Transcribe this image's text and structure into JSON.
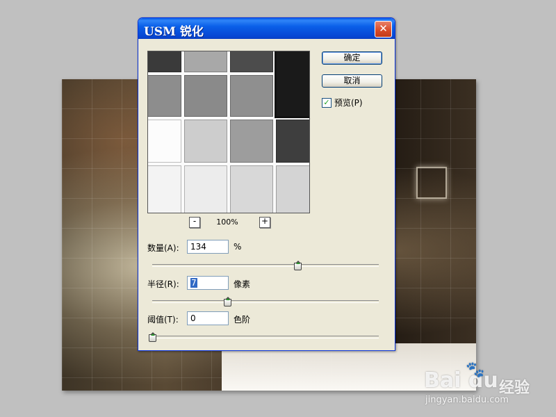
{
  "dialog": {
    "title": "USM 锐化",
    "close_label": "✕",
    "ok_label": "确定",
    "cancel_label": "取消",
    "preview_checkbox": {
      "label": "预览(P)",
      "checked": true,
      "check_mark": "✓"
    }
  },
  "preview": {
    "zoom_out_label": "-",
    "zoom_in_label": "+",
    "zoom_level": "100%"
  },
  "params": {
    "amount": {
      "label": "数量(A):",
      "value": "134",
      "unit": "%",
      "slider_fraction": 0.64
    },
    "radius": {
      "label": "半径(R):",
      "value": "7",
      "unit": "像素",
      "slider_fraction": 0.33
    },
    "threshold": {
      "label": "阈值(T):",
      "value": "0",
      "unit": "色阶",
      "slider_fraction": 0.0
    }
  },
  "watermark": {
    "logo": "Bai du",
    "paw_icon": "baidu-paw-icon",
    "sub": "经验",
    "url": "jingyan.baidu.com"
  },
  "colors": {
    "title_bar": "#0a5fe8",
    "close_button": "#d94d2a",
    "dialog_bg": "#ece9d8",
    "slider_accent": "#2e9e2e"
  }
}
